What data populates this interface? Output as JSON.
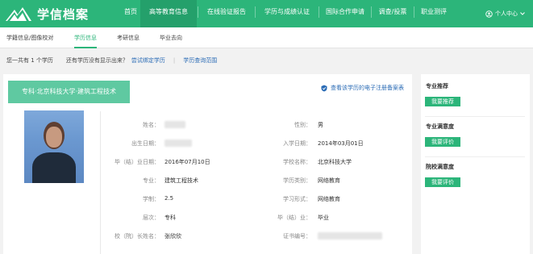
{
  "brand": {
    "name": "学信档案",
    "color": "#2cb57a"
  },
  "nav": {
    "items": [
      {
        "label": "首页"
      },
      {
        "label": "高等教育信息"
      },
      {
        "label": "在线验证报告"
      },
      {
        "label": "学历与成绩认证"
      },
      {
        "label": "国际合作申请"
      },
      {
        "label": "调查/投票"
      },
      {
        "label": "职业测评"
      }
    ],
    "active": "高等教育信息",
    "user_menu": "个人中心"
  },
  "subnav": {
    "items": [
      {
        "label": "学籍信息/图像校对"
      },
      {
        "label": "学历信息"
      },
      {
        "label": "考研信息"
      },
      {
        "label": "毕业去向"
      }
    ],
    "active": "学历信息"
  },
  "info": {
    "count_text": "您一共有 1 个学历",
    "question": "还有学历没有显示出来？",
    "bind_link": "尝试绑定学历",
    "range_link": "学历查询范围"
  },
  "record": {
    "title": "专科·北京科技大学·建筑工程技术",
    "e_register_link": "查看该学历的电子注册备案表",
    "left_fields": [
      {
        "label": "姓名：",
        "value": ""
      },
      {
        "label": "出生日期：",
        "value": ""
      },
      {
        "label": "毕（结）业日期：",
        "value": "2016年07月10日"
      },
      {
        "label": "专业：",
        "value": "建筑工程技术"
      },
      {
        "label": "学制：",
        "value": "2.5"
      },
      {
        "label": "层次：",
        "value": "专科"
      },
      {
        "label": "校（院）长姓名：",
        "value": "张欣欣"
      }
    ],
    "right_fields": [
      {
        "label": "性别：",
        "value": "男"
      },
      {
        "label": "入学日期：",
        "value": "2014年03月01日"
      },
      {
        "label": "学校名称：",
        "value": "北京科技大学"
      },
      {
        "label": "学历类别：",
        "value": "网络教育"
      },
      {
        "label": "学习形式：",
        "value": "网络教育"
      },
      {
        "label": "毕（结）业：",
        "value": "毕业"
      },
      {
        "label": "证书编号：",
        "value": ""
      }
    ]
  },
  "sidebar": {
    "sections": [
      {
        "title": "专业推荐",
        "button": "我要推荐"
      },
      {
        "title": "专业满意度",
        "button": "我要评价"
      },
      {
        "title": "院校满意度",
        "button": "我要评价"
      }
    ]
  }
}
